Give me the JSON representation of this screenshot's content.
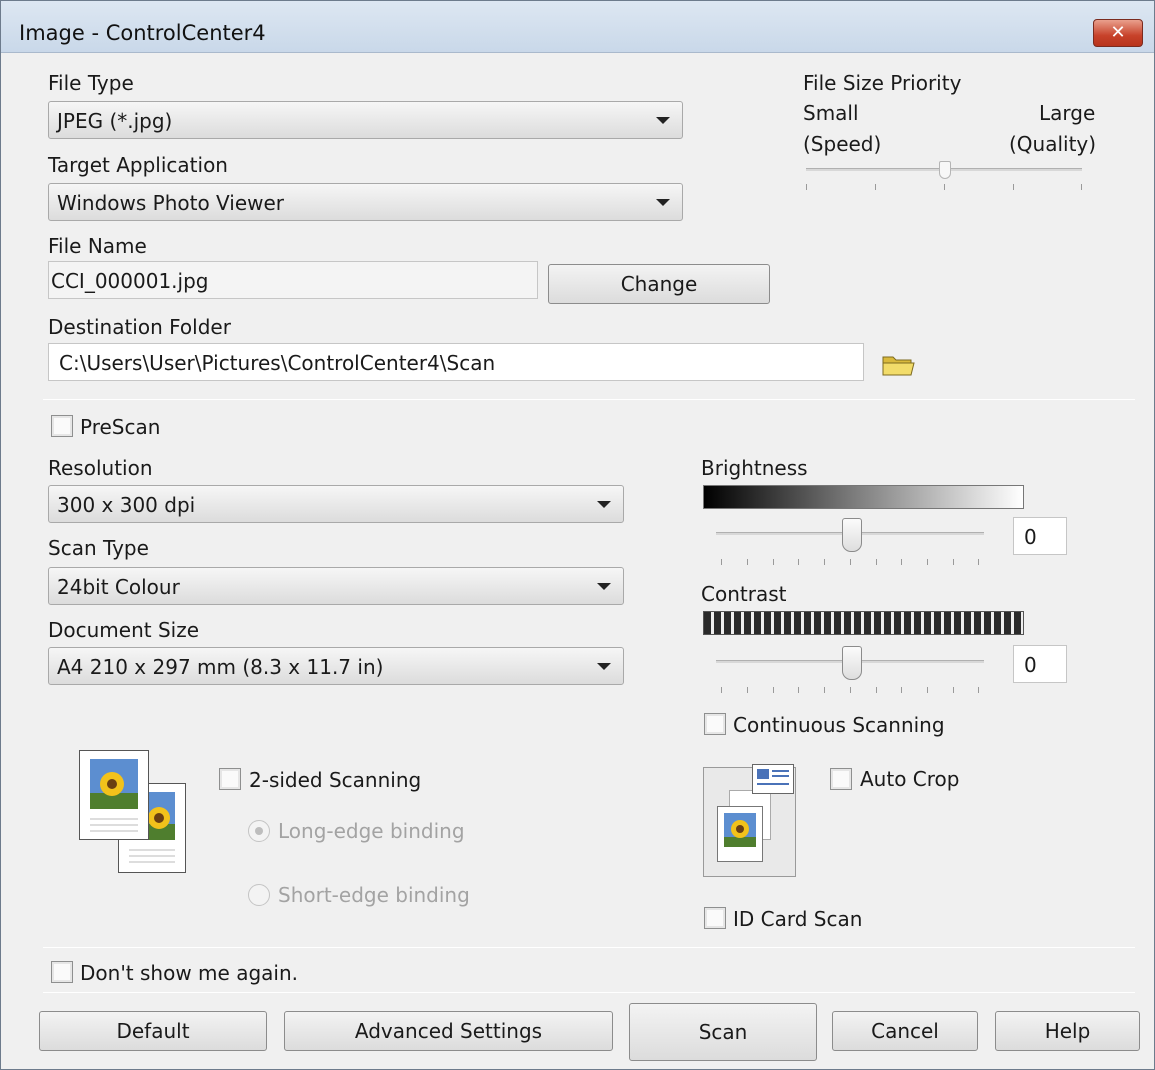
{
  "window": {
    "title": "Image - ControlCenter4",
    "close_glyph": "✕"
  },
  "file_type": {
    "label": "File Type",
    "value": "JPEG (*.jpg)"
  },
  "target_app": {
    "label": "Target Application",
    "value": "Windows Photo Viewer"
  },
  "file_name": {
    "label": "File Name",
    "value": "CCI_000001.jpg",
    "change_label": "Change"
  },
  "destination": {
    "label": "Destination Folder",
    "value": "C:\\Users\\User\\Pictures\\ControlCenter4\\Scan"
  },
  "file_size": {
    "label": "File Size Priority",
    "small": "Small",
    "speed": "(Speed)",
    "large": "Large",
    "quality": "(Quality)",
    "level": 0.5
  },
  "prescan": {
    "label": "PreScan",
    "checked": false
  },
  "resolution": {
    "label": "Resolution",
    "value": "300 x 300 dpi"
  },
  "scan_type": {
    "label": "Scan Type",
    "value": "24bit Colour"
  },
  "document_size": {
    "label": "Document Size",
    "value": "A4 210 x 297 mm (8.3 x 11.7 in)"
  },
  "brightness": {
    "label": "Brightness",
    "value": "0",
    "level": 0.5
  },
  "contrast": {
    "label": "Contrast",
    "value": "0",
    "level": 0.5
  },
  "continuous": {
    "label": "Continuous Scanning",
    "checked": false
  },
  "two_sided": {
    "label": "2-sided Scanning",
    "checked": false,
    "long_edge": "Long-edge binding",
    "short_edge": "Short-edge binding"
  },
  "auto_crop": {
    "label": "Auto Crop",
    "checked": false
  },
  "id_card": {
    "label": "ID Card Scan",
    "checked": false
  },
  "dont_show": {
    "label": "Don't show me again.",
    "checked": false
  },
  "buttons": {
    "default": "Default",
    "advanced": "Advanced Settings",
    "scan": "Scan",
    "cancel": "Cancel",
    "help": "Help"
  },
  "icons": [
    "folder-icon",
    "duplex-pages-icon",
    "auto-crop-icon"
  ],
  "colors": {
    "title_bg": "#c9d8e9",
    "close_btn": "#c7422a",
    "window_bg": "#f0f0f0"
  }
}
